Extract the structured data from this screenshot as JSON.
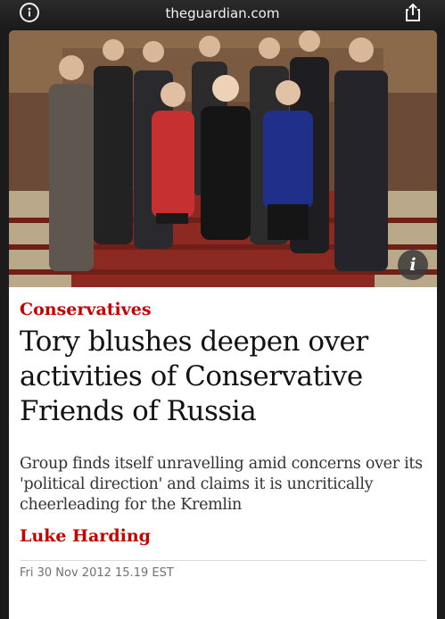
{
  "browser": {
    "url": "theguardian.com",
    "info_icon": "info-circle-icon",
    "share_icon": "share-icon"
  },
  "article": {
    "photo_info_label": "i",
    "kicker": "Conservatives",
    "headline": "Tory blushes deepen over activities of Conservative Friends of Russia",
    "standfirst": "Group finds itself unravelling amid concerns over its 'political direction' and claims it is uncritically cheerleading for the Kremlin",
    "byline": "Luke Harding",
    "date": "Fri 30 Nov 2012 15.19 EST"
  },
  "colors": {
    "accent_red": "#c70000",
    "text": "#121212",
    "frame": "#1b1b1b"
  }
}
